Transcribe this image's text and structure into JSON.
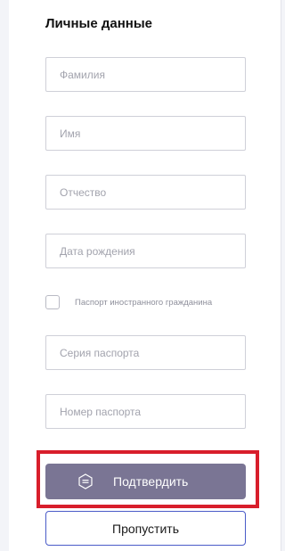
{
  "section": {
    "title": "Личные данные"
  },
  "fields": {
    "last_name": {
      "placeholder": "Фамилия",
      "value": ""
    },
    "first_name": {
      "placeholder": "Имя",
      "value": ""
    },
    "middle_name": {
      "placeholder": "Отчество",
      "value": ""
    },
    "birth_date": {
      "placeholder": "Дата рождения",
      "value": ""
    },
    "passport_series": {
      "placeholder": "Серия паспорта",
      "value": ""
    },
    "passport_number": {
      "placeholder": "Номер паспорта",
      "value": ""
    }
  },
  "foreign_passport": {
    "label": "Паспорт иностранного гражданина",
    "checked": false
  },
  "buttons": {
    "confirm_label": "Подтвердить",
    "confirm_icon": "gosuslugi-logo-icon",
    "skip_label": "Пропустить"
  },
  "colors": {
    "confirm_bg": "#7a7594",
    "skip_border": "#4a5bc8",
    "highlight": "#d81e2b"
  }
}
